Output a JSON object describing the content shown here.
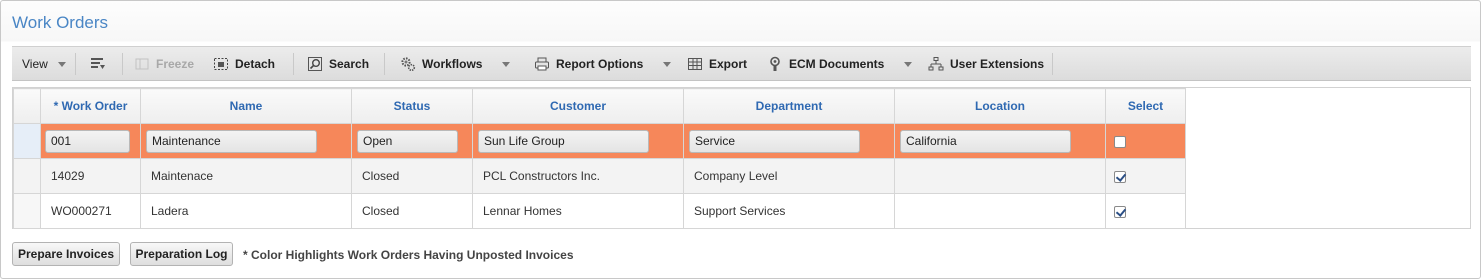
{
  "page": {
    "title": "Work Orders"
  },
  "toolbar": {
    "view": "View",
    "freeze": "Freeze",
    "detach": "Detach",
    "search": "Search",
    "workflows": "Workflows",
    "report_options": "Report Options",
    "export": "Export",
    "ecm_documents": "ECM Documents",
    "user_extensions": "User Extensions"
  },
  "table": {
    "headers": [
      "* Work Order",
      "Name",
      "Status",
      "Customer",
      "Department",
      "Location",
      "Select"
    ],
    "rows": [
      {
        "work_order": "001",
        "name": "Maintenance",
        "status": "Open",
        "customer": "Sun Life Group",
        "department": "Service",
        "location": "California",
        "selected": false
      },
      {
        "work_order": "14029",
        "name": "Maintenace",
        "status": "Closed",
        "customer": "PCL Constructors Inc.",
        "department": "Company Level",
        "location": "",
        "selected": true
      },
      {
        "work_order": "WO000271",
        "name": "Ladera",
        "status": "Closed",
        "customer": "Lennar Homes",
        "department": "Support Services",
        "location": "",
        "selected": true
      }
    ]
  },
  "footer": {
    "prepare_invoices": "Prepare Invoices",
    "preparation_log": "Preparation Log",
    "note": "* Color Highlights Work Orders Having Unposted Invoices"
  },
  "colors": {
    "accent": "#4a86c5",
    "header_text": "#2f69b2",
    "highlight_row": "#f6875a"
  },
  "icons": [
    "caret-down-icon",
    "column-settings-icon",
    "freeze-icon",
    "detach-icon",
    "search-icon",
    "workflows-gear-icon",
    "printer-icon",
    "export-grid-icon",
    "ecm-document-icon",
    "user-extensions-icon",
    "checkbox-icon"
  ]
}
